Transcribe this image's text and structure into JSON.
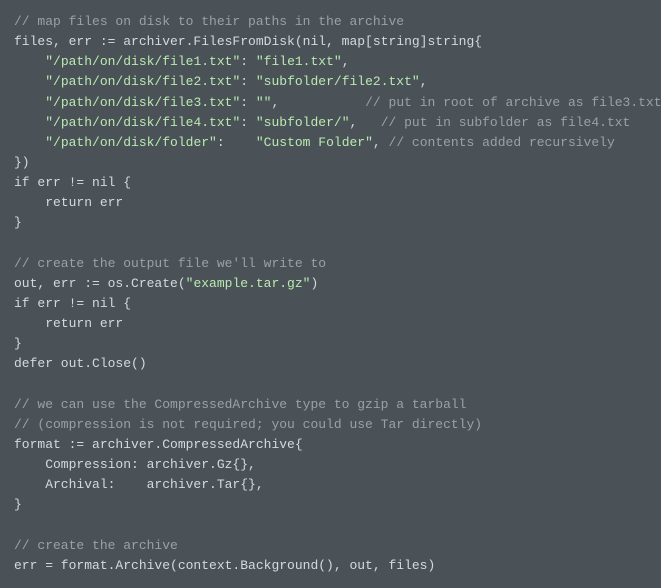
{
  "code": {
    "c1": "// map files on disk to their paths in the archive",
    "l2a": "files, err := archiver.FilesFromDisk(nil, map[string]string{",
    "l3s1": "\"/path/on/disk/file1.txt\"",
    "l3s2": "\"file1.txt\"",
    "l4s1": "\"/path/on/disk/file2.txt\"",
    "l4s2": "\"subfolder/file2.txt\"",
    "l5s1": "\"/path/on/disk/file3.txt\"",
    "l5s2": "\"\"",
    "l5c": "// put in root of archive as file3.txt",
    "l6s1": "\"/path/on/disk/file4.txt\"",
    "l6s2": "\"subfolder/\"",
    "l6c": "// put in subfolder as file4.txt",
    "l7s1": "\"/path/on/disk/folder\"",
    "l7s2": "\"Custom Folder\"",
    "l7c": "// contents added recursively",
    "l8": "})",
    "l9": "if err != nil {",
    "l10": "    return err",
    "l11": "}",
    "c2": "// create the output file we'll write to",
    "l13a": "out, err := os.Create(",
    "l13s": "\"example.tar.gz\"",
    "l13b": ")",
    "l14": "if err != nil {",
    "l15": "    return err",
    "l16": "}",
    "l17": "defer out.Close()",
    "c3": "// we can use the CompressedArchive type to gzip a tarball",
    "c4": "// (compression is not required; you could use Tar directly)",
    "l20": "format := archiver.CompressedArchive{",
    "l21": "    Compression: archiver.Gz{},",
    "l22": "    Archival:    archiver.Tar{},",
    "l23": "}",
    "c5": "// create the archive",
    "l25": "err = format.Archive(context.Background(), out, files)"
  }
}
